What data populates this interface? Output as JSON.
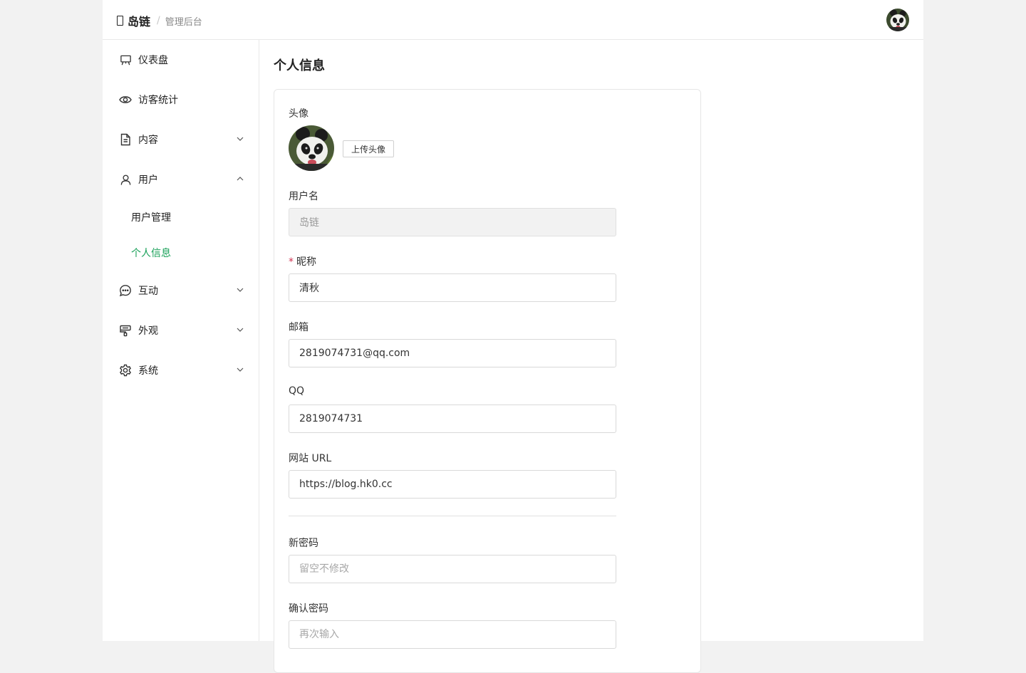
{
  "header": {
    "brand_name": "岛链",
    "separator": "/",
    "subtitle": "管理后台"
  },
  "sidebar": {
    "items": [
      {
        "label": "仪表盘",
        "icon": "dashboard-icon"
      },
      {
        "label": "访客统计",
        "icon": "eye-icon"
      },
      {
        "label": "内容",
        "icon": "document-icon",
        "expanded": false
      },
      {
        "label": "用户",
        "icon": "user-icon",
        "expanded": true
      },
      {
        "label": "互动",
        "icon": "chat-icon",
        "expanded": false
      },
      {
        "label": "外观",
        "icon": "brush-icon",
        "expanded": false
      },
      {
        "label": "系统",
        "icon": "gear-icon",
        "expanded": false
      }
    ],
    "user_submenu": [
      {
        "label": "用户管理",
        "active": false
      },
      {
        "label": "个人信息",
        "active": true
      }
    ],
    "active_color": "#18a058"
  },
  "main": {
    "title": "个人信息",
    "form": {
      "avatar_label": "头像",
      "upload_button": "上传头像",
      "username_label": "用户名",
      "username_value": "岛链",
      "nickname_required_mark": "*",
      "nickname_label": "昵称",
      "nickname_value": "清秋",
      "email_label": "邮箱",
      "email_value": "2819074731@qq.com",
      "qq_label": "QQ",
      "qq_value": "2819074731",
      "website_label": "网站 URL",
      "website_value": "https://blog.hk0.cc",
      "new_password_label": "新密码",
      "new_password_placeholder": "留空不修改",
      "confirm_password_label": "确认密码",
      "confirm_password_placeholder": "再次输入"
    }
  }
}
